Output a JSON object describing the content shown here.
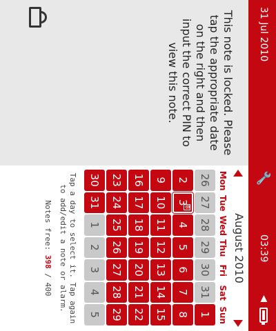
{
  "status_bar": {
    "date": "31 Jul 2010",
    "time": "03:39",
    "icons": [
      "battery-icon",
      "speaker-icon",
      "wrench-icon"
    ]
  },
  "lock_panel": {
    "message": "This note is locked. Please tap the appropriate date on the right and then input the correct PIN to view this note.",
    "icon": "padlock-icon"
  },
  "calendar": {
    "title": "August 2010",
    "days_of_week": [
      "Mon",
      "Tue",
      "Wed",
      "Thu",
      "Fri",
      "Sat",
      "Sun"
    ],
    "selected_day": 3,
    "rows": [
      [
        {
          "d": "26",
          "m": "out"
        },
        {
          "d": "27",
          "m": "out"
        },
        {
          "d": "28",
          "m": "out"
        },
        {
          "d": "29",
          "m": "out"
        },
        {
          "d": "30",
          "m": "out"
        },
        {
          "d": "31",
          "m": "out"
        },
        {
          "d": "1",
          "m": "in"
        }
      ],
      [
        {
          "d": "2",
          "m": "in"
        },
        {
          "d": "3",
          "m": "in",
          "sel": true,
          "badge": "B"
        },
        {
          "d": "4",
          "m": "in"
        },
        {
          "d": "5",
          "m": "in"
        },
        {
          "d": "6",
          "m": "in"
        },
        {
          "d": "7",
          "m": "in"
        },
        {
          "d": "8",
          "m": "in"
        }
      ],
      [
        {
          "d": "9",
          "m": "in"
        },
        {
          "d": "10",
          "m": "in"
        },
        {
          "d": "11",
          "m": "in"
        },
        {
          "d": "12",
          "m": "in"
        },
        {
          "d": "13",
          "m": "in"
        },
        {
          "d": "14",
          "m": "in"
        },
        {
          "d": "15",
          "m": "in"
        }
      ],
      [
        {
          "d": "16",
          "m": "in"
        },
        {
          "d": "17",
          "m": "in"
        },
        {
          "d": "18",
          "m": "in"
        },
        {
          "d": "19",
          "m": "in"
        },
        {
          "d": "20",
          "m": "in"
        },
        {
          "d": "21",
          "m": "in"
        },
        {
          "d": "22",
          "m": "in"
        }
      ],
      [
        {
          "d": "23",
          "m": "in"
        },
        {
          "d": "24",
          "m": "in"
        },
        {
          "d": "25",
          "m": "in"
        },
        {
          "d": "26",
          "m": "in"
        },
        {
          "d": "27",
          "m": "in"
        },
        {
          "d": "28",
          "m": "in"
        },
        {
          "d": "29",
          "m": "in"
        }
      ],
      [
        {
          "d": "30",
          "m": "in"
        },
        {
          "d": "31",
          "m": "in"
        },
        {
          "d": "1",
          "m": "out"
        },
        {
          "d": "2",
          "m": "out"
        },
        {
          "d": "3",
          "m": "out"
        },
        {
          "d": "4",
          "m": "out"
        },
        {
          "d": "5",
          "m": "out"
        }
      ]
    ],
    "help_text": "Tap a day to select it. Tap again to add/edit a note or alarm.",
    "notes_label": "Notes free:",
    "notes_free": "398",
    "notes_sep": "/",
    "notes_total": "400"
  },
  "colors": {
    "accent": "#c40812",
    "out_of_month": "#c9c9c9",
    "panel_bg": "#e8e8e8"
  }
}
